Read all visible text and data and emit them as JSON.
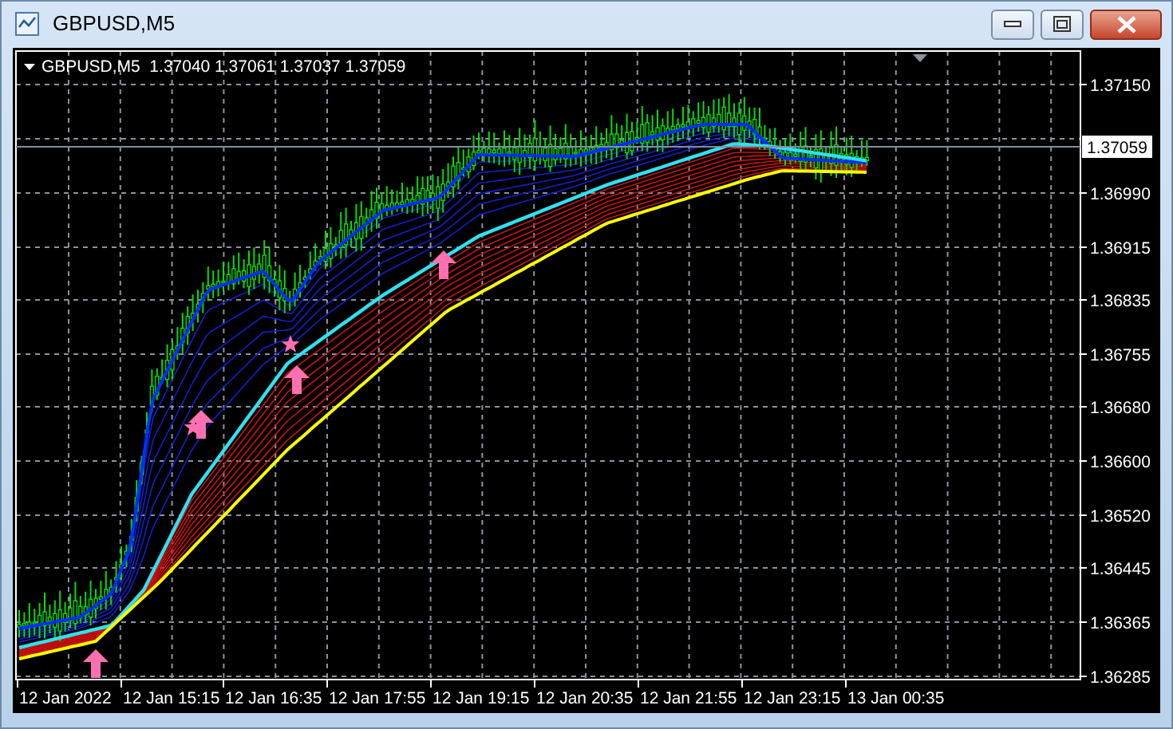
{
  "window": {
    "title": "GBPUSD,M5"
  },
  "chart": {
    "header": "GBPUSD,M5  1.37040 1.37061 1.37037 1.37059",
    "current_price": "1.37059",
    "price_labels": [
      "1.37150",
      "1.36990",
      "1.36915",
      "1.36835",
      "1.36755",
      "1.36680",
      "1.36600",
      "1.36520",
      "1.36445",
      "1.36365",
      "1.36285"
    ],
    "time_labels": [
      "12 Jan 2022",
      "12 Jan 15:15",
      "12 Jan 16:35",
      "12 Jan 17:55",
      "12 Jan 19:15",
      "12 Jan 20:35",
      "12 Jan 21:55",
      "12 Jan 23:15",
      "13 Jan 00:35"
    ]
  }
}
